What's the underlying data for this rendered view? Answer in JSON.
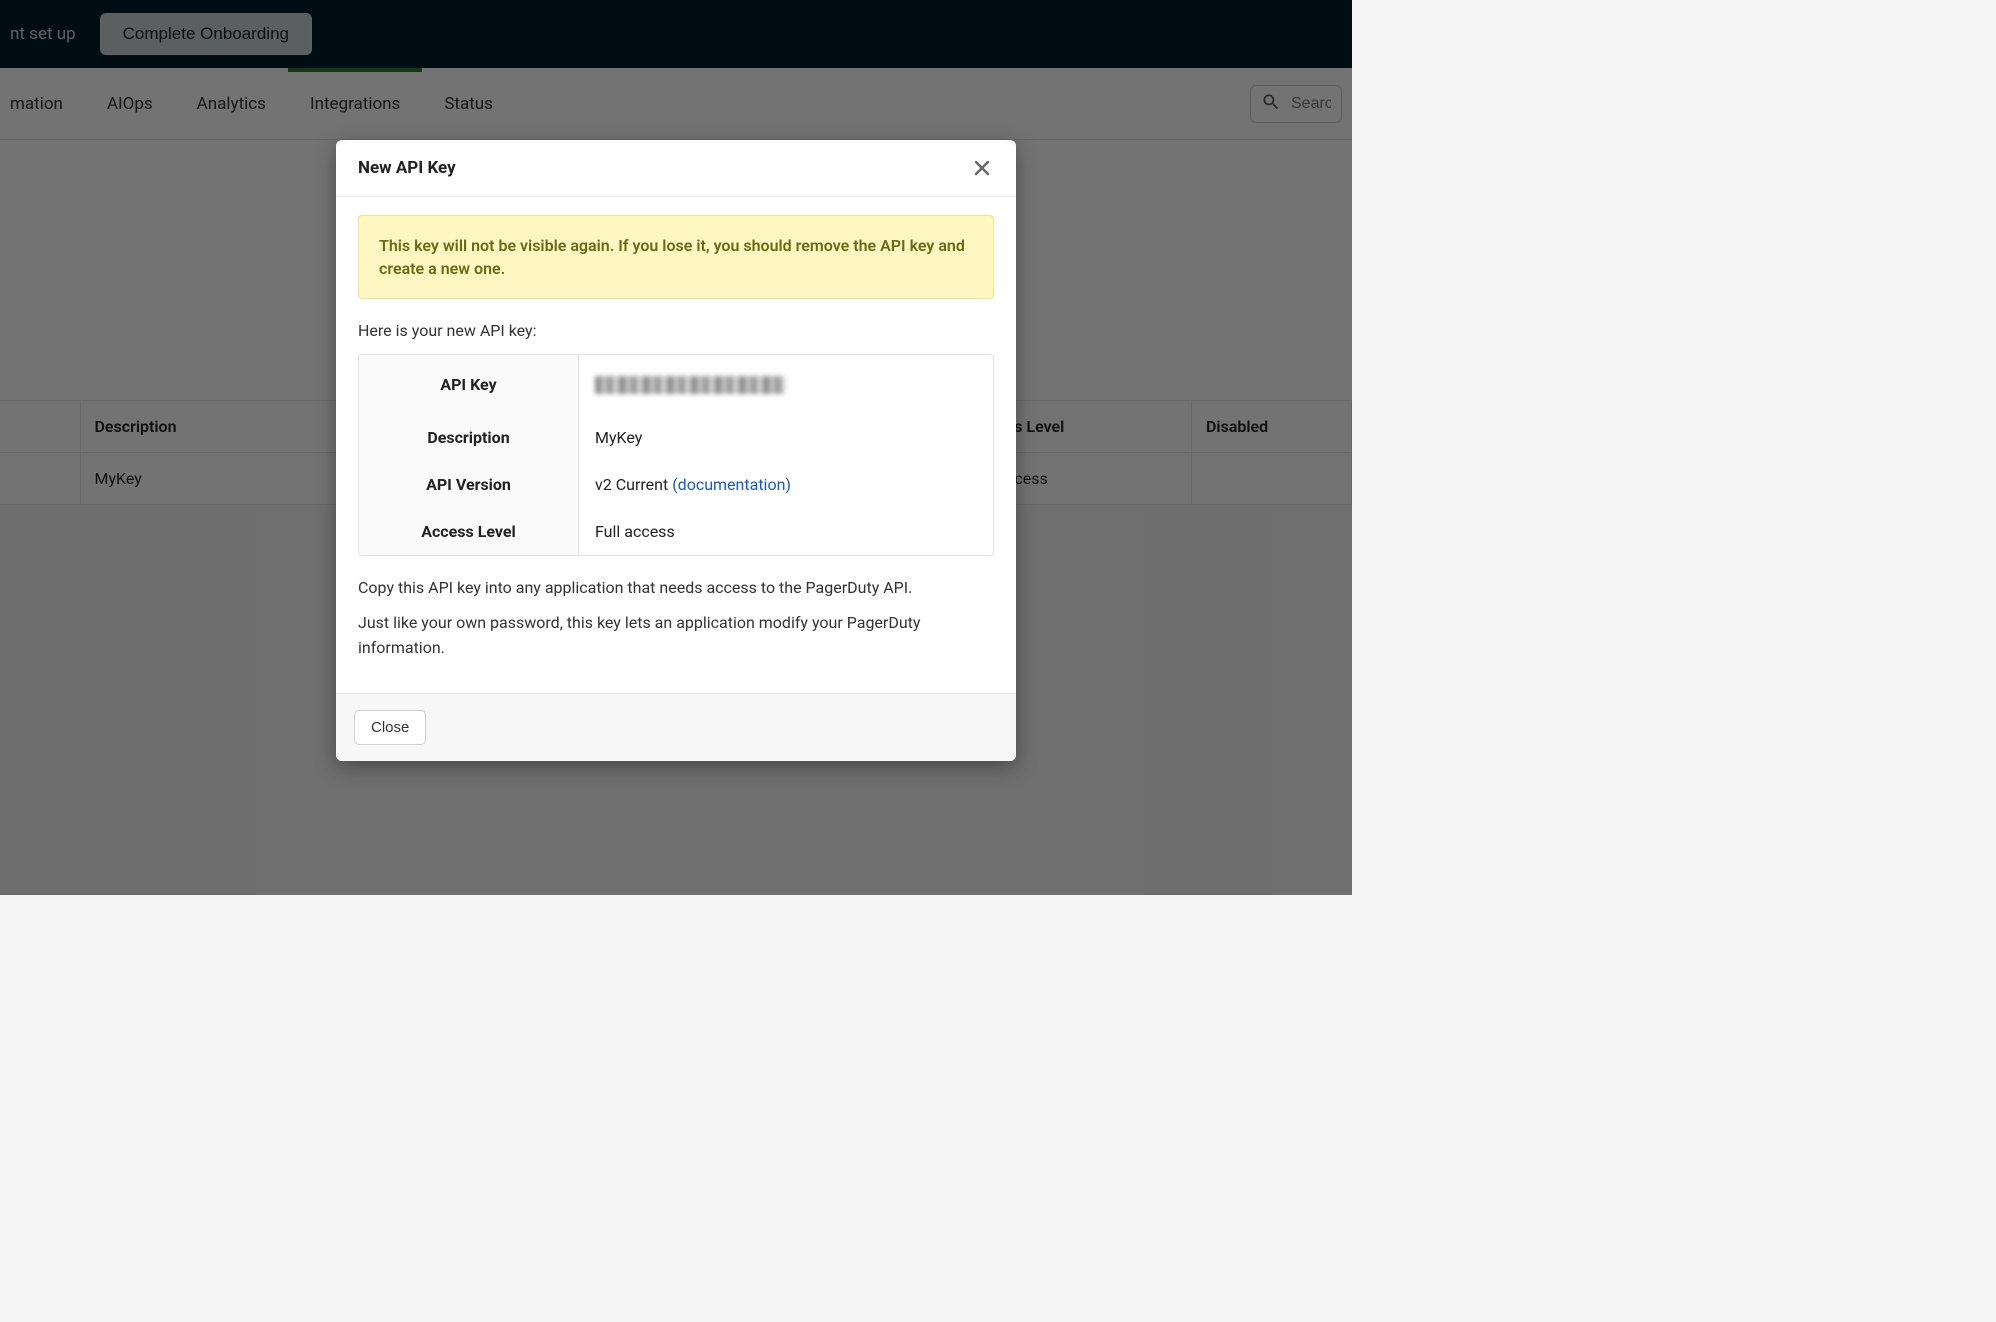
{
  "topbar": {
    "setup_text_partial": "nt set up",
    "onboarding_button": "Complete Onboarding"
  },
  "nav": {
    "items": [
      "mation",
      "AIOps",
      "Analytics",
      "Integrations",
      "Status"
    ],
    "active_index": 3,
    "search_placeholder": "Searc"
  },
  "bg_table": {
    "headers": {
      "description": "Description",
      "access_level": "ss Level",
      "disabled": "Disabled"
    },
    "row": {
      "description": "MyKey",
      "access_level": "ccess",
      "disabled": ""
    }
  },
  "modal": {
    "title": "New API Key",
    "warning": "This key will not be visible again. If you lose it, you should remove the API key and create a new one.",
    "intro": "Here is your new API key:",
    "labels": {
      "api_key": "API Key",
      "description": "Description",
      "api_version": "API Version",
      "access_level": "Access Level"
    },
    "values": {
      "api_key_redacted": true,
      "description": "MyKey",
      "api_version_prefix": "v2 Current",
      "api_version_doc_text": "(documentation)",
      "access_level": "Full access"
    },
    "help1": "Copy this API key into any application that needs access to the PagerDuty API.",
    "help2": "Just like your own password, this key lets an application modify your PagerDuty information.",
    "close_button": "Close"
  }
}
